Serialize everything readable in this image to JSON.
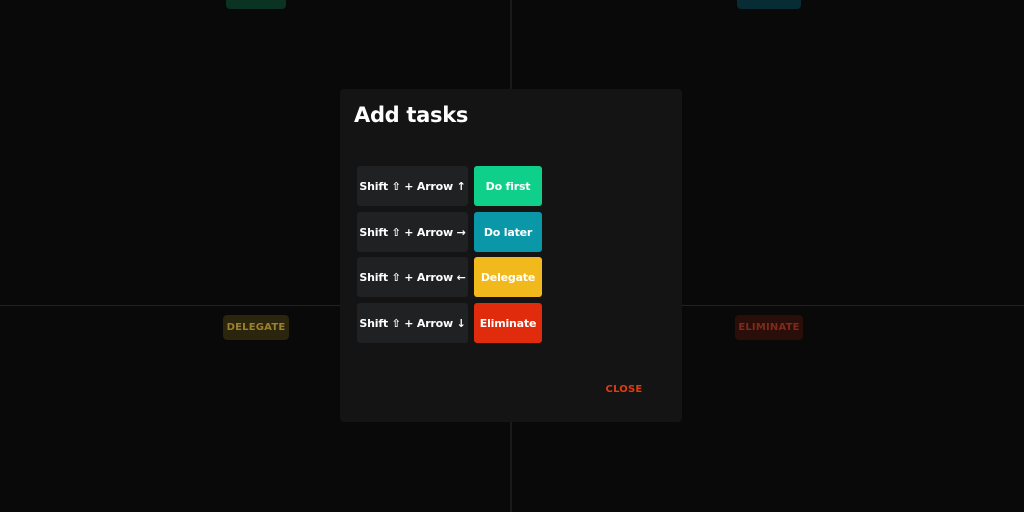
{
  "colors": {
    "do_first": "#0fd08a",
    "do_later": "#0a97a8",
    "delegate": "#f2b91c",
    "eliminate": "#e02c0c",
    "close": "#e23b12"
  },
  "quadrants": {
    "delegate_label": "DELEGATE",
    "eliminate_label": "ELIMINATE"
  },
  "modal": {
    "title": "Add tasks",
    "close_label": "CLOSE",
    "shortcuts": [
      {
        "keys": "Shift ⇧ + Arrow ↑",
        "action": "Do first",
        "icon": "arrow-up-icon"
      },
      {
        "keys": "Shift ⇧ + Arrow →",
        "action": "Do later",
        "icon": "arrow-right-icon"
      },
      {
        "keys": "Shift ⇧ + Arrow ←",
        "action": "Delegate",
        "icon": "arrow-left-icon"
      },
      {
        "keys": "Shift ⇧ + Arrow ↓",
        "action": "Eliminate",
        "icon": "arrow-down-icon"
      }
    ]
  }
}
